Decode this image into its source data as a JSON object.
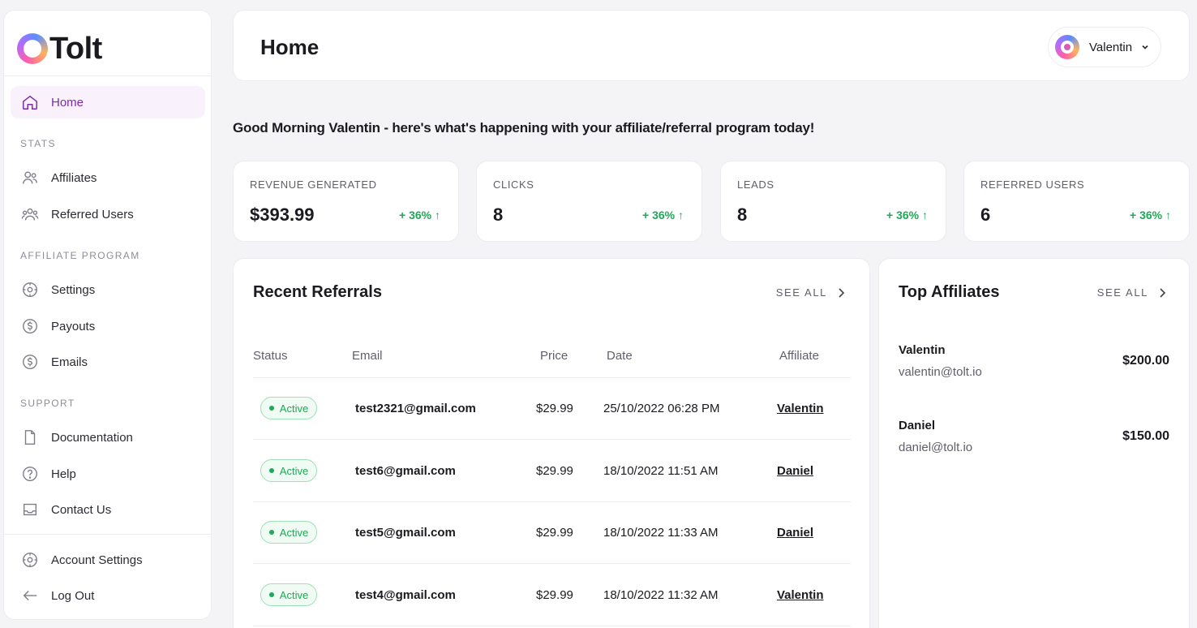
{
  "brand": {
    "name": "Tolt"
  },
  "sidebar": {
    "home": "Home",
    "sections": {
      "stats": "STATS",
      "affiliate_program": "AFFILIATE PROGRAM",
      "support": "SUPPORT"
    },
    "items": {
      "affiliates": "Affiliates",
      "referred_users": "Referred Users",
      "settings": "Settings",
      "payouts": "Payouts",
      "emails": "Emails",
      "documentation": "Documentation",
      "help": "Help",
      "contact_us": "Contact Us",
      "account_settings": "Account Settings",
      "log_out": "Log Out"
    },
    "active_item": "home",
    "icons": [
      "home-icon",
      "users-icon",
      "group-icon",
      "settings-icon",
      "dollar-icon",
      "dollar-icon",
      "document-icon",
      "help-icon",
      "inbox-icon",
      "settings-icon",
      "arrow-left-icon"
    ]
  },
  "header": {
    "title": "Home",
    "user": {
      "name": "Valentin"
    }
  },
  "greeting": "Good Morning Valentin - here's what's happening with your affiliate/referral program today!",
  "stats": [
    {
      "label": "REVENUE GENERATED",
      "value": "$393.99",
      "change": "+ 36% ↑"
    },
    {
      "label": "CLICKS",
      "value": "8",
      "change": "+ 36% ↑"
    },
    {
      "label": "LEADS",
      "value": "8",
      "change": "+ 36% ↑"
    },
    {
      "label": "REFERRED USERS",
      "value": "6",
      "change": "+ 36% ↑"
    }
  ],
  "recent_referrals": {
    "title": "Recent Referrals",
    "see_all": "SEE ALL",
    "columns": [
      "Status",
      "Email",
      "Price",
      "Date",
      "Affiliate"
    ],
    "rows": [
      {
        "status": "Active",
        "email": "test2321@gmail.com",
        "price": "$29.99",
        "date": "25/10/2022 06:28 PM",
        "affiliate": "Valentin"
      },
      {
        "status": "Active",
        "email": "test6@gmail.com",
        "price": "$29.99",
        "date": "18/10/2022 11:51 AM",
        "affiliate": "Daniel"
      },
      {
        "status": "Active",
        "email": "test5@gmail.com",
        "price": "$29.99",
        "date": "18/10/2022 11:33 AM",
        "affiliate": "Daniel"
      },
      {
        "status": "Active",
        "email": "test4@gmail.com",
        "price": "$29.99",
        "date": "18/10/2022 11:32 AM",
        "affiliate": "Valentin"
      }
    ]
  },
  "top_affiliates": {
    "title": "Top Affiliates",
    "see_all": "SEE ALL",
    "items": [
      {
        "name": "Valentin",
        "email": "valentin@tolt.io",
        "amount": "$200.00"
      },
      {
        "name": "Daniel",
        "email": "daniel@tolt.io",
        "amount": "$150.00"
      }
    ]
  },
  "colors": {
    "accent": "#7a2bb0",
    "active_bg": "#f9f1fb",
    "positive": "#1fa857",
    "background": "#f4f4f6"
  }
}
